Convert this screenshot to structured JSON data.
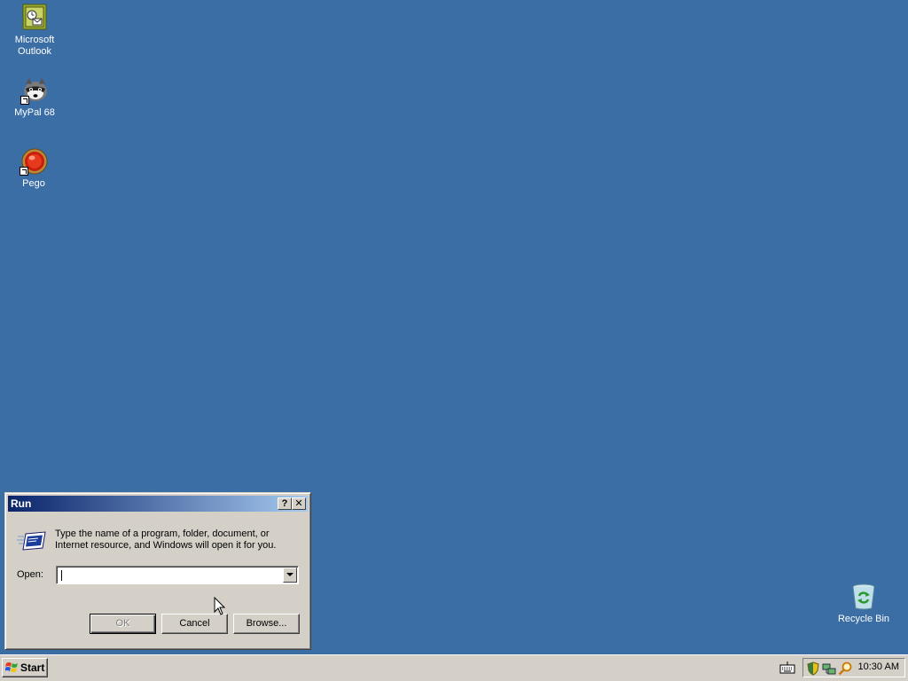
{
  "desktop": {
    "background": "#3a6ea5",
    "icons": [
      {
        "label": "Microsoft Outlook",
        "icon": "outlook-icon"
      },
      {
        "label": "MyPal 68",
        "icon": "raccoon-icon"
      },
      {
        "label": "Pego",
        "icon": "pego-icon"
      },
      {
        "label": "Recycle Bin",
        "icon": "recycle-bin-icon"
      }
    ]
  },
  "run_dialog": {
    "title": "Run",
    "help_button": "?",
    "close_button": "✕",
    "description": "Type the name of a program, folder, document, or Internet resource, and Windows will open it for you.",
    "open_label": "Open:",
    "open_value": "",
    "buttons": {
      "ok": "OK",
      "cancel": "Cancel",
      "browse": "Browse..."
    }
  },
  "taskbar": {
    "start_label": "Start",
    "clock": "10:30 AM",
    "tray_icons": [
      "security-shield-icon",
      "network-icon",
      "search-icon"
    ]
  }
}
